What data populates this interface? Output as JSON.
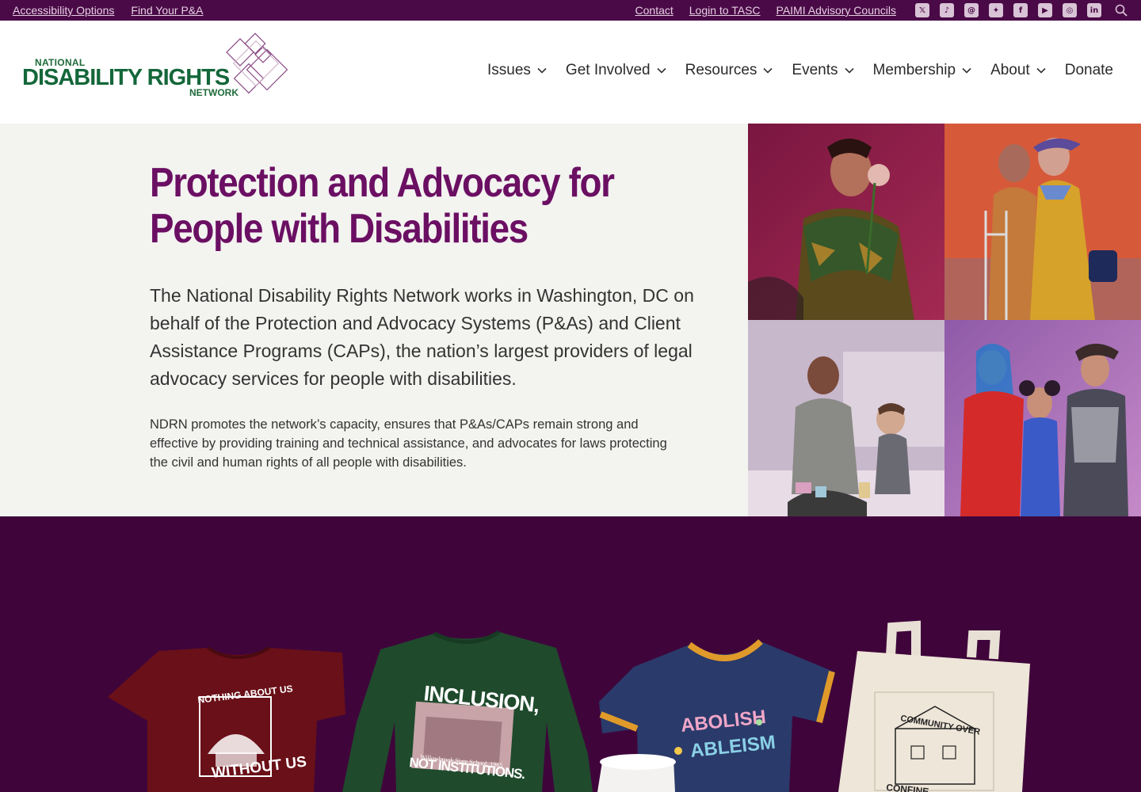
{
  "utility": {
    "left_links": [
      "Accessibility Options",
      "Find Your P&A"
    ],
    "right_links": [
      "Contact",
      "Login to TASC",
      "PAIMI Advisory Councils"
    ],
    "social_icons": [
      "x-icon",
      "tiktok-icon",
      "threads-icon",
      "bluesky-icon",
      "facebook-icon",
      "youtube-icon",
      "instagram-icon",
      "linkedin-icon"
    ]
  },
  "logo": {
    "line1": "NATIONAL",
    "line2": "DISABILITY RIGHTS",
    "line3": "NETWORK"
  },
  "nav": {
    "items": [
      {
        "label": "Issues",
        "has_menu": true
      },
      {
        "label": "Get Involved",
        "has_menu": true
      },
      {
        "label": "Resources",
        "has_menu": true
      },
      {
        "label": "Events",
        "has_menu": true
      },
      {
        "label": "Membership",
        "has_menu": true
      },
      {
        "label": "About",
        "has_menu": true
      },
      {
        "label": "Donate",
        "has_menu": false
      }
    ]
  },
  "hero": {
    "title": "Protection and Advocacy for People with Disabilities",
    "lead": "The National Disability Rights Network works in Washington, DC on behalf of the Protection and Advocacy Systems (P&As) and Client Assistance Programs (CAPs), the nation’s largest providers of legal advocacy services for people with disabilities.",
    "body": "NDRN promotes the network’s capacity, ensures that P&As/CAPs remain strong and effective by providing training and technical assistance, and advocates for laws protecting the civil and human rights of all people with disabilities."
  },
  "merch": {
    "shirt1": {
      "top": "NOTHING ABOUT US",
      "bottom": "WITHOUT US"
    },
    "shirt2": {
      "top": "INCLUSION,",
      "caption": "Willowbrook State School, 1965",
      "bottom": "NOT INSTITUTIONS."
    },
    "shirt3": {
      "line1": "ABOLISH",
      "line2": "ABLEISM"
    },
    "tote": {
      "top": "COMMUNITY OVER",
      "bottom": "CONFINE"
    }
  },
  "colors": {
    "brand_purple": "#6b0f63",
    "utility_bg": "#4a0a47",
    "merch_bg": "#3f053b",
    "logo_green": "#14673a"
  }
}
